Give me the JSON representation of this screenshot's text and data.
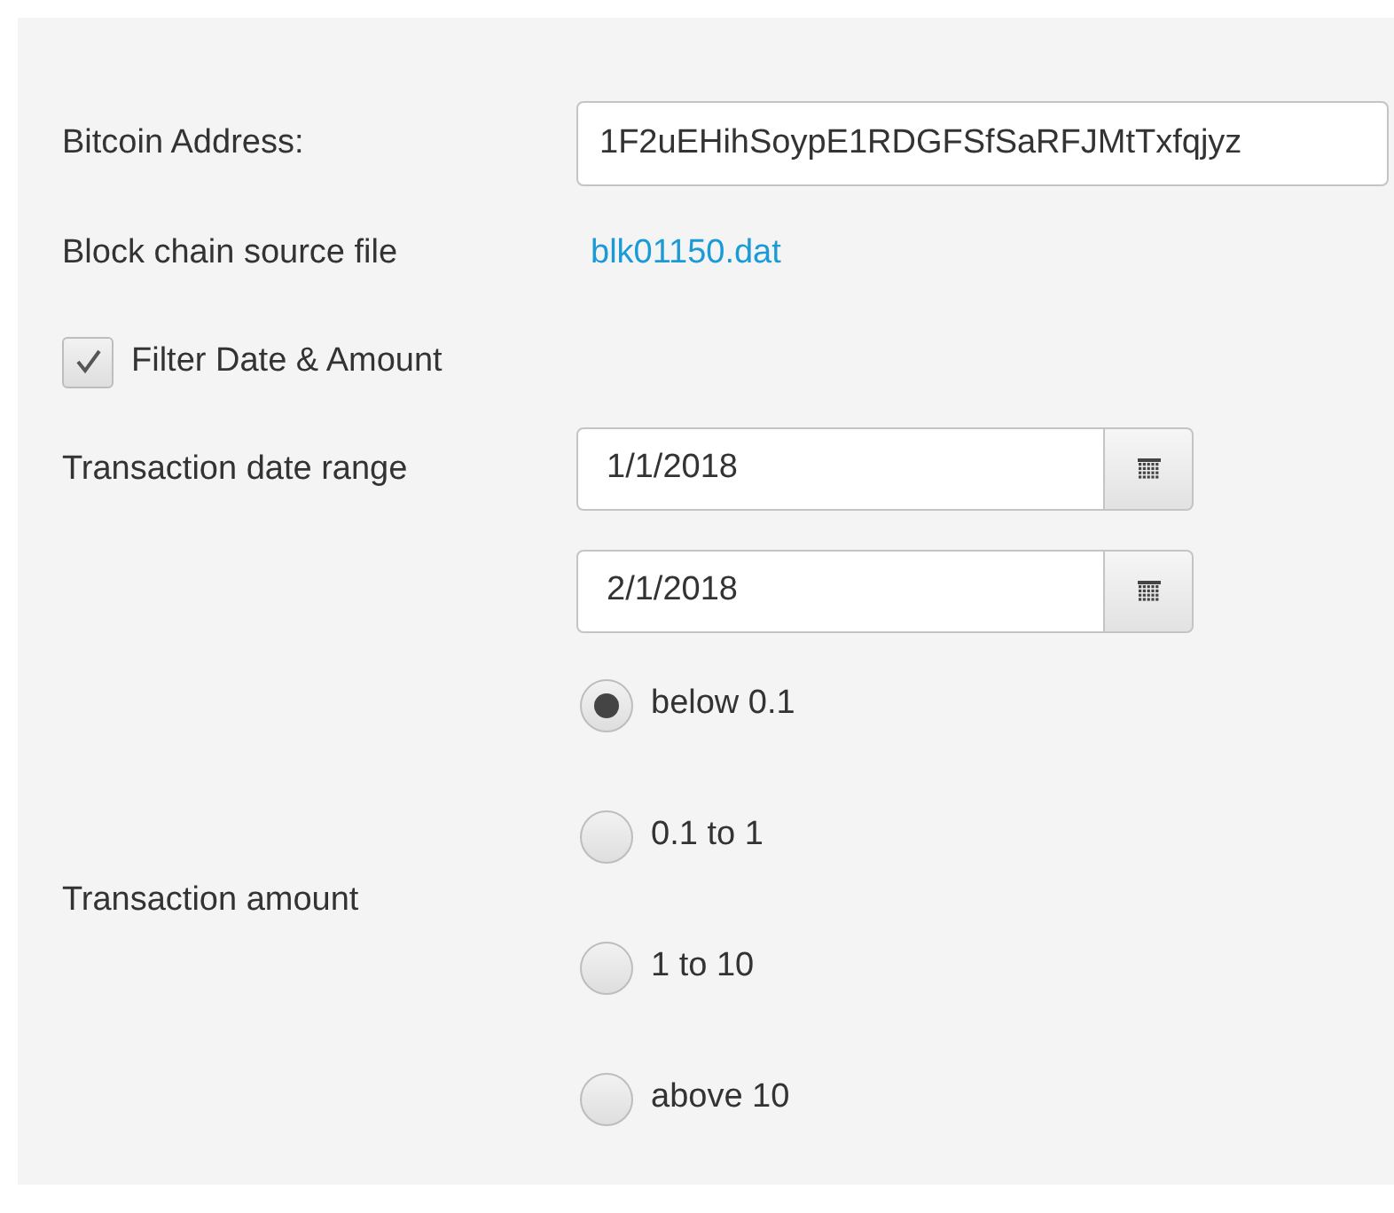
{
  "address": {
    "label": "Bitcoin Address:",
    "value": "1F2uEHihSoypE1RDGFSfSaRFJMtTxfqjyz"
  },
  "source": {
    "label": "Block chain source file",
    "link": "blk01150.dat"
  },
  "filter": {
    "label": "Filter Date & Amount",
    "checked": true
  },
  "date_range": {
    "label": "Transaction date range",
    "from": "1/1/2018",
    "to": "2/1/2018"
  },
  "amount": {
    "label": "Transaction amount",
    "options": [
      {
        "label": "below 0.1",
        "selected": true
      },
      {
        "label": "0.1 to 1",
        "selected": false
      },
      {
        "label": "1 to 10",
        "selected": false
      },
      {
        "label": "above 10",
        "selected": false
      }
    ]
  }
}
